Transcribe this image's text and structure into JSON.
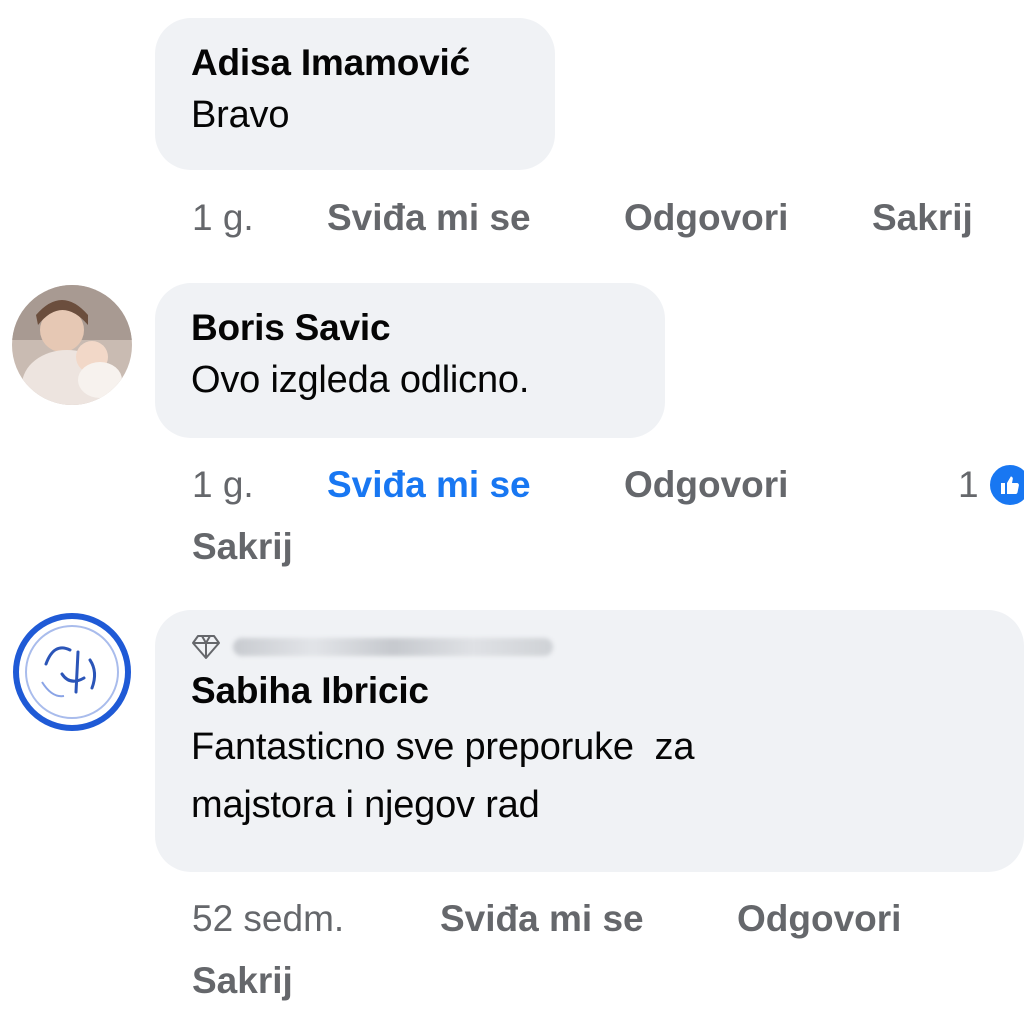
{
  "comments": [
    {
      "author": "Adisa Imamović",
      "text": "Bravo",
      "time": "1 g.",
      "like_label": "Sviđa mi se",
      "reply_label": "Odgovori",
      "hide_label": "Sakrij"
    },
    {
      "author": "Boris Savic",
      "text": "Ovo izgleda odlicno.",
      "time": "1 g.",
      "like_label": "Sviđa mi se",
      "reply_label": "Odgovori",
      "hide_label": "Sakrij",
      "reaction_count": "1",
      "liked": true
    },
    {
      "badge_icon": "diamond-icon",
      "author": "Sabiha Ibricic",
      "text_line1": "Fantasticno sve preporuke  za",
      "text_line2": "majstora i njegov rad",
      "time": "52 sedm.",
      "like_label": "Sviđa mi se",
      "reply_label": "Odgovori",
      "hide_label": "Sakrij"
    }
  ],
  "colors": {
    "bubble": "#f0f2f5",
    "secondary_text": "#65676b",
    "accent": "#1877f2"
  }
}
